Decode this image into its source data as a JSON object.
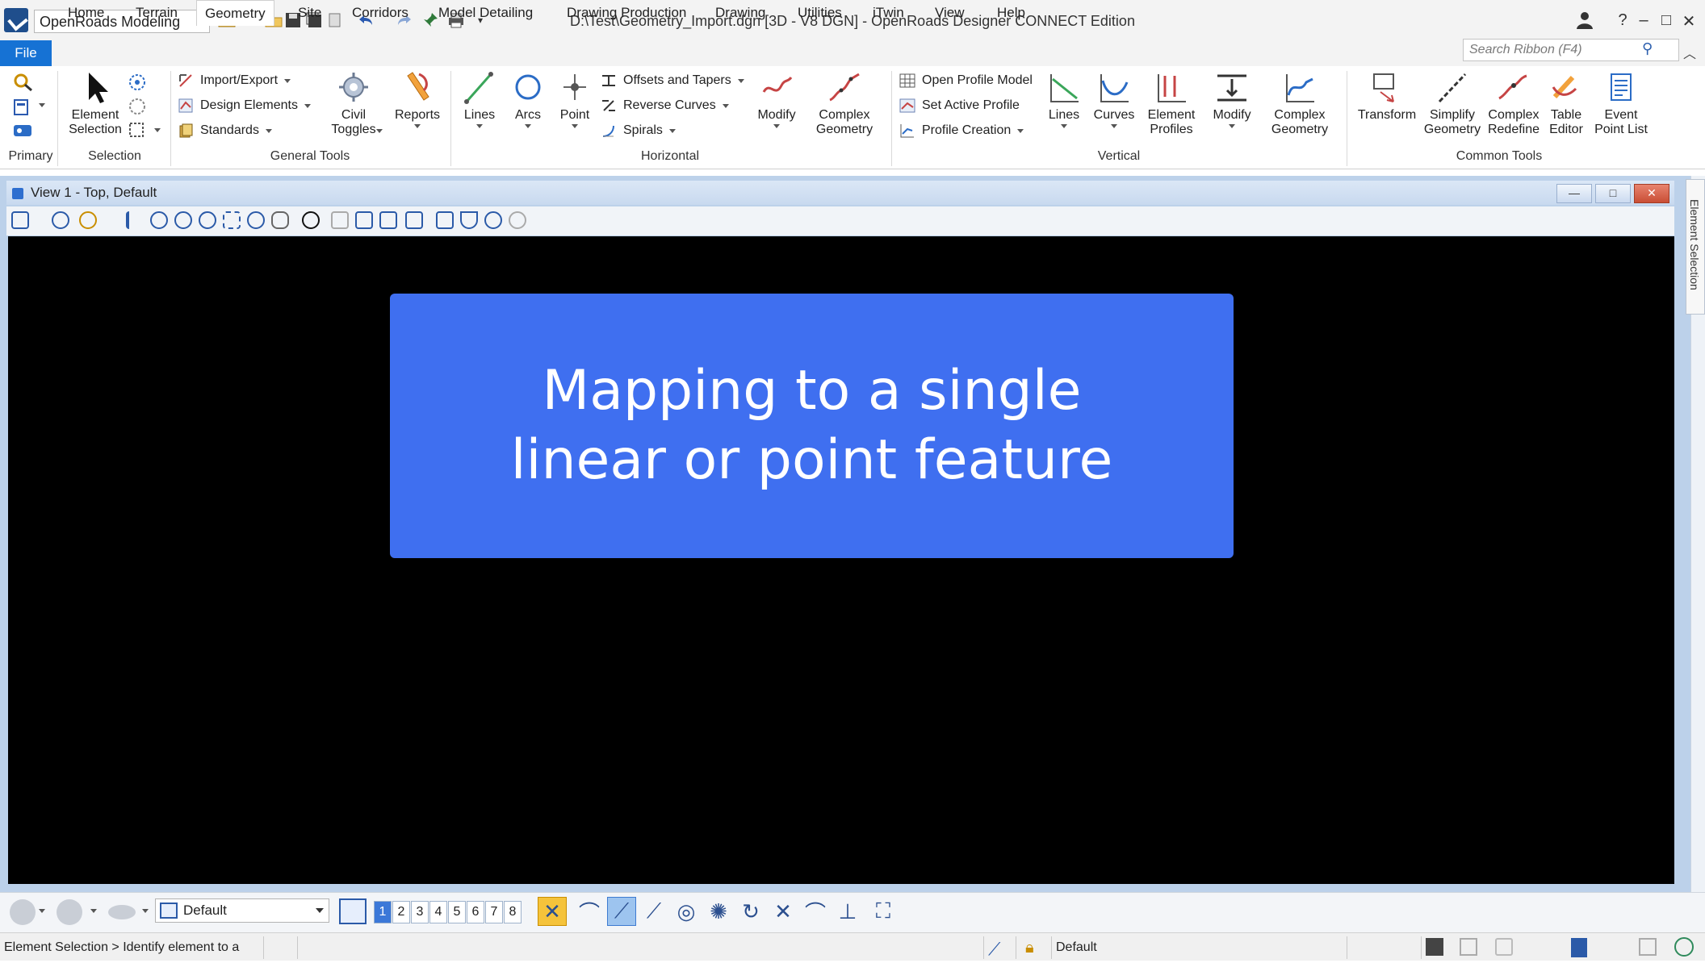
{
  "app": {
    "workflow": "OpenRoads Modeling",
    "window_title": "D:\\Test\\Geometry_Import.dgn [3D - V8 DGN] - OpenRoads Designer CONNECT Edition",
    "controls": {
      "help": "?",
      "minimize": "–",
      "maximize": "□",
      "close": "✕"
    }
  },
  "tabs": {
    "file": "File",
    "items": [
      "Home",
      "Terrain",
      "Geometry",
      "Site",
      "Corridors",
      "Model Detailing",
      "Drawing Production",
      "Drawing",
      "Utilities",
      "iTwin",
      "View",
      "Help"
    ],
    "active": "Geometry"
  },
  "search": {
    "placeholder": "Search Ribbon (F4)"
  },
  "ribbon": {
    "groups": {
      "primary": "Primary",
      "selection": "Selection",
      "general_tools": "General Tools",
      "horizontal": "Horizontal",
      "vertical": "Vertical",
      "common_tools": "Common Tools"
    },
    "selection": {
      "element_selection_l1": "Element",
      "element_selection_l2": "Selection"
    },
    "general": {
      "import_export": "Import/Export",
      "design_elements": "Design Elements",
      "standards": "Standards",
      "civil_toggles_l1": "Civil",
      "civil_toggles_l2": "Toggles",
      "reports": "Reports"
    },
    "horizontal": {
      "lines": "Lines",
      "arcs": "Arcs",
      "point": "Point",
      "offsets_tapers": "Offsets and Tapers",
      "reverse_curves": "Reverse Curves",
      "spirals": "Spirals",
      "modify": "Modify",
      "complex_l1": "Complex",
      "complex_l2": "Geometry"
    },
    "vertical": {
      "open_profile_model": "Open Profile Model",
      "set_active_profile": "Set Active Profile",
      "profile_creation": "Profile Creation",
      "lines": "Lines",
      "curves": "Curves",
      "element_profiles_l1": "Element",
      "element_profiles_l2": "Profiles",
      "modify": "Modify",
      "complex_l1": "Complex",
      "complex_l2": "Geometry"
    },
    "common": {
      "transform": "Transform",
      "simplify_l1": "Simplify",
      "simplify_l2": "Geometry",
      "complex_redefine_l1": "Complex",
      "complex_redefine_l2": "Redefine",
      "table_editor_l1": "Table",
      "table_editor_l2": "Editor",
      "event_point_list_l1": "Event",
      "event_point_list_l2": "Point List"
    }
  },
  "view": {
    "title": "View 1 - Top, Default",
    "side_panel": "Element Selection",
    "overlay_text": "Mapping to a single\nlinear or point feature",
    "colors": {
      "canvas": "#000000",
      "overlay": "#3f6ff0"
    }
  },
  "bottom": {
    "view_group": "Default",
    "view_numbers": [
      "1",
      "2",
      "3",
      "4",
      "5",
      "6",
      "7",
      "8"
    ],
    "active_view": "1"
  },
  "status": {
    "message": "Element Selection > Identify element to a",
    "level": "Default"
  }
}
